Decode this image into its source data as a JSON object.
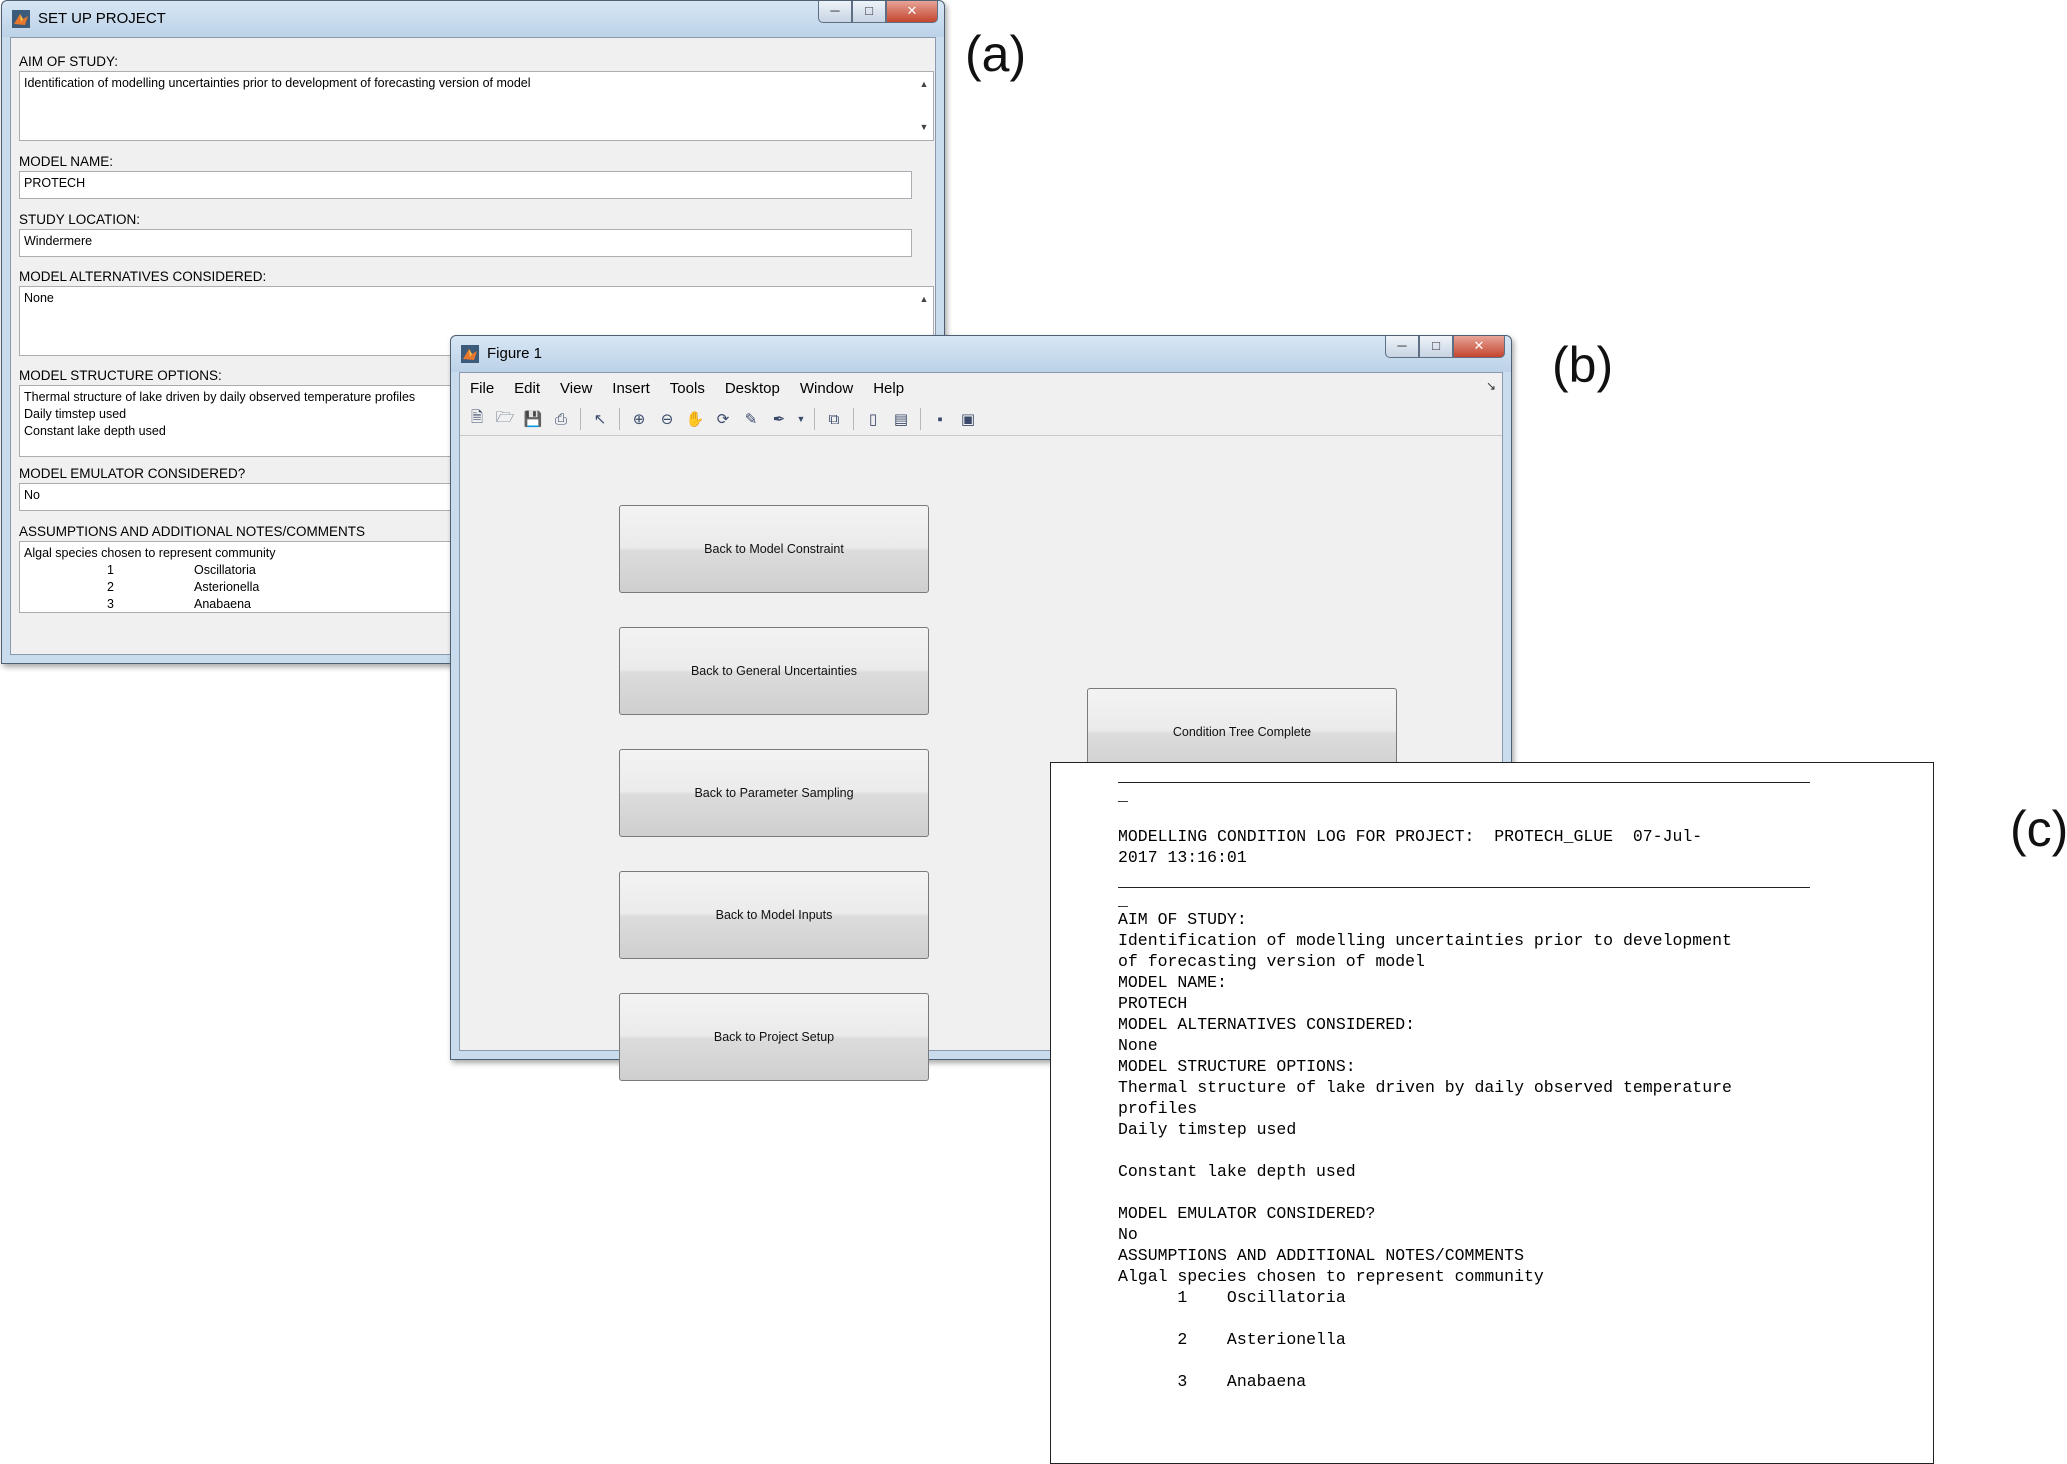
{
  "panel_labels": {
    "a": "(a)",
    "b": "(b)",
    "c": "(c)"
  },
  "window_a": {
    "title": "SET UP PROJECT",
    "aim_label": "AIM OF STUDY:",
    "aim_value": "Identification of modelling uncertainties prior to development of forecasting version of model",
    "model_name_label": "MODEL NAME:",
    "model_name_value": "PROTECH",
    "study_location_label": "STUDY LOCATION:",
    "study_location_value": "Windermere",
    "alternatives_label": "MODEL ALTERNATIVES CONSIDERED:",
    "alternatives_value": "None",
    "structure_label": "MODEL STRUCTURE OPTIONS:",
    "structure_lines": [
      "Thermal structure of lake driven by daily observed temperature profiles",
      "Daily timstep used",
      "Constant lake depth used"
    ],
    "emulator_label": "MODEL EMULATOR CONSIDERED?",
    "emulator_value": "No",
    "assumptions_label": "ASSUMPTIONS AND ADDITIONAL NOTES/COMMENTS",
    "assumptions_intro": "Algal species chosen to represent community",
    "species": [
      {
        "num": "1",
        "name": "Oscillatoria"
      },
      {
        "num": "2",
        "name": "Asterionella"
      },
      {
        "num": "3",
        "name": "Anabaena"
      }
    ]
  },
  "window_b": {
    "title": "Figure 1",
    "menu": [
      "File",
      "Edit",
      "View",
      "Insert",
      "Tools",
      "Desktop",
      "Window",
      "Help"
    ],
    "buttons": {
      "model_constraint": "Back to Model Constraint",
      "general_uncertainties": "Back to General Uncertainties",
      "parameter_sampling": "Back to Parameter Sampling",
      "model_inputs": "Back to Model Inputs",
      "project_setup": "Back to Project Setup",
      "condition_tree_complete": "Condition Tree Complete"
    }
  },
  "log_c": {
    "underscore": "_",
    "header_line1": "MODELLING CONDITION LOG FOR PROJECT:  PROTECH_GLUE  07-Jul-",
    "header_line2": "2017 13:16:01",
    "lines": [
      "AIM OF STUDY:",
      "Identification of modelling uncertainties prior to development",
      "of forecasting version of model",
      "MODEL NAME:",
      "PROTECH",
      "MODEL ALTERNATIVES CONSIDERED:",
      "None",
      "MODEL STRUCTURE OPTIONS:",
      "Thermal structure of lake driven by daily observed temperature",
      "profiles",
      "Daily timstep used",
      "",
      "Constant lake depth used",
      "",
      "MODEL EMULATOR CONSIDERED?",
      "No",
      "ASSUMPTIONS AND ADDITIONAL NOTES/COMMENTS",
      "Algal species chosen to represent community",
      "      1    Oscillatoria",
      "",
      "      2    Asterionella",
      "",
      "      3    Anabaena"
    ]
  }
}
